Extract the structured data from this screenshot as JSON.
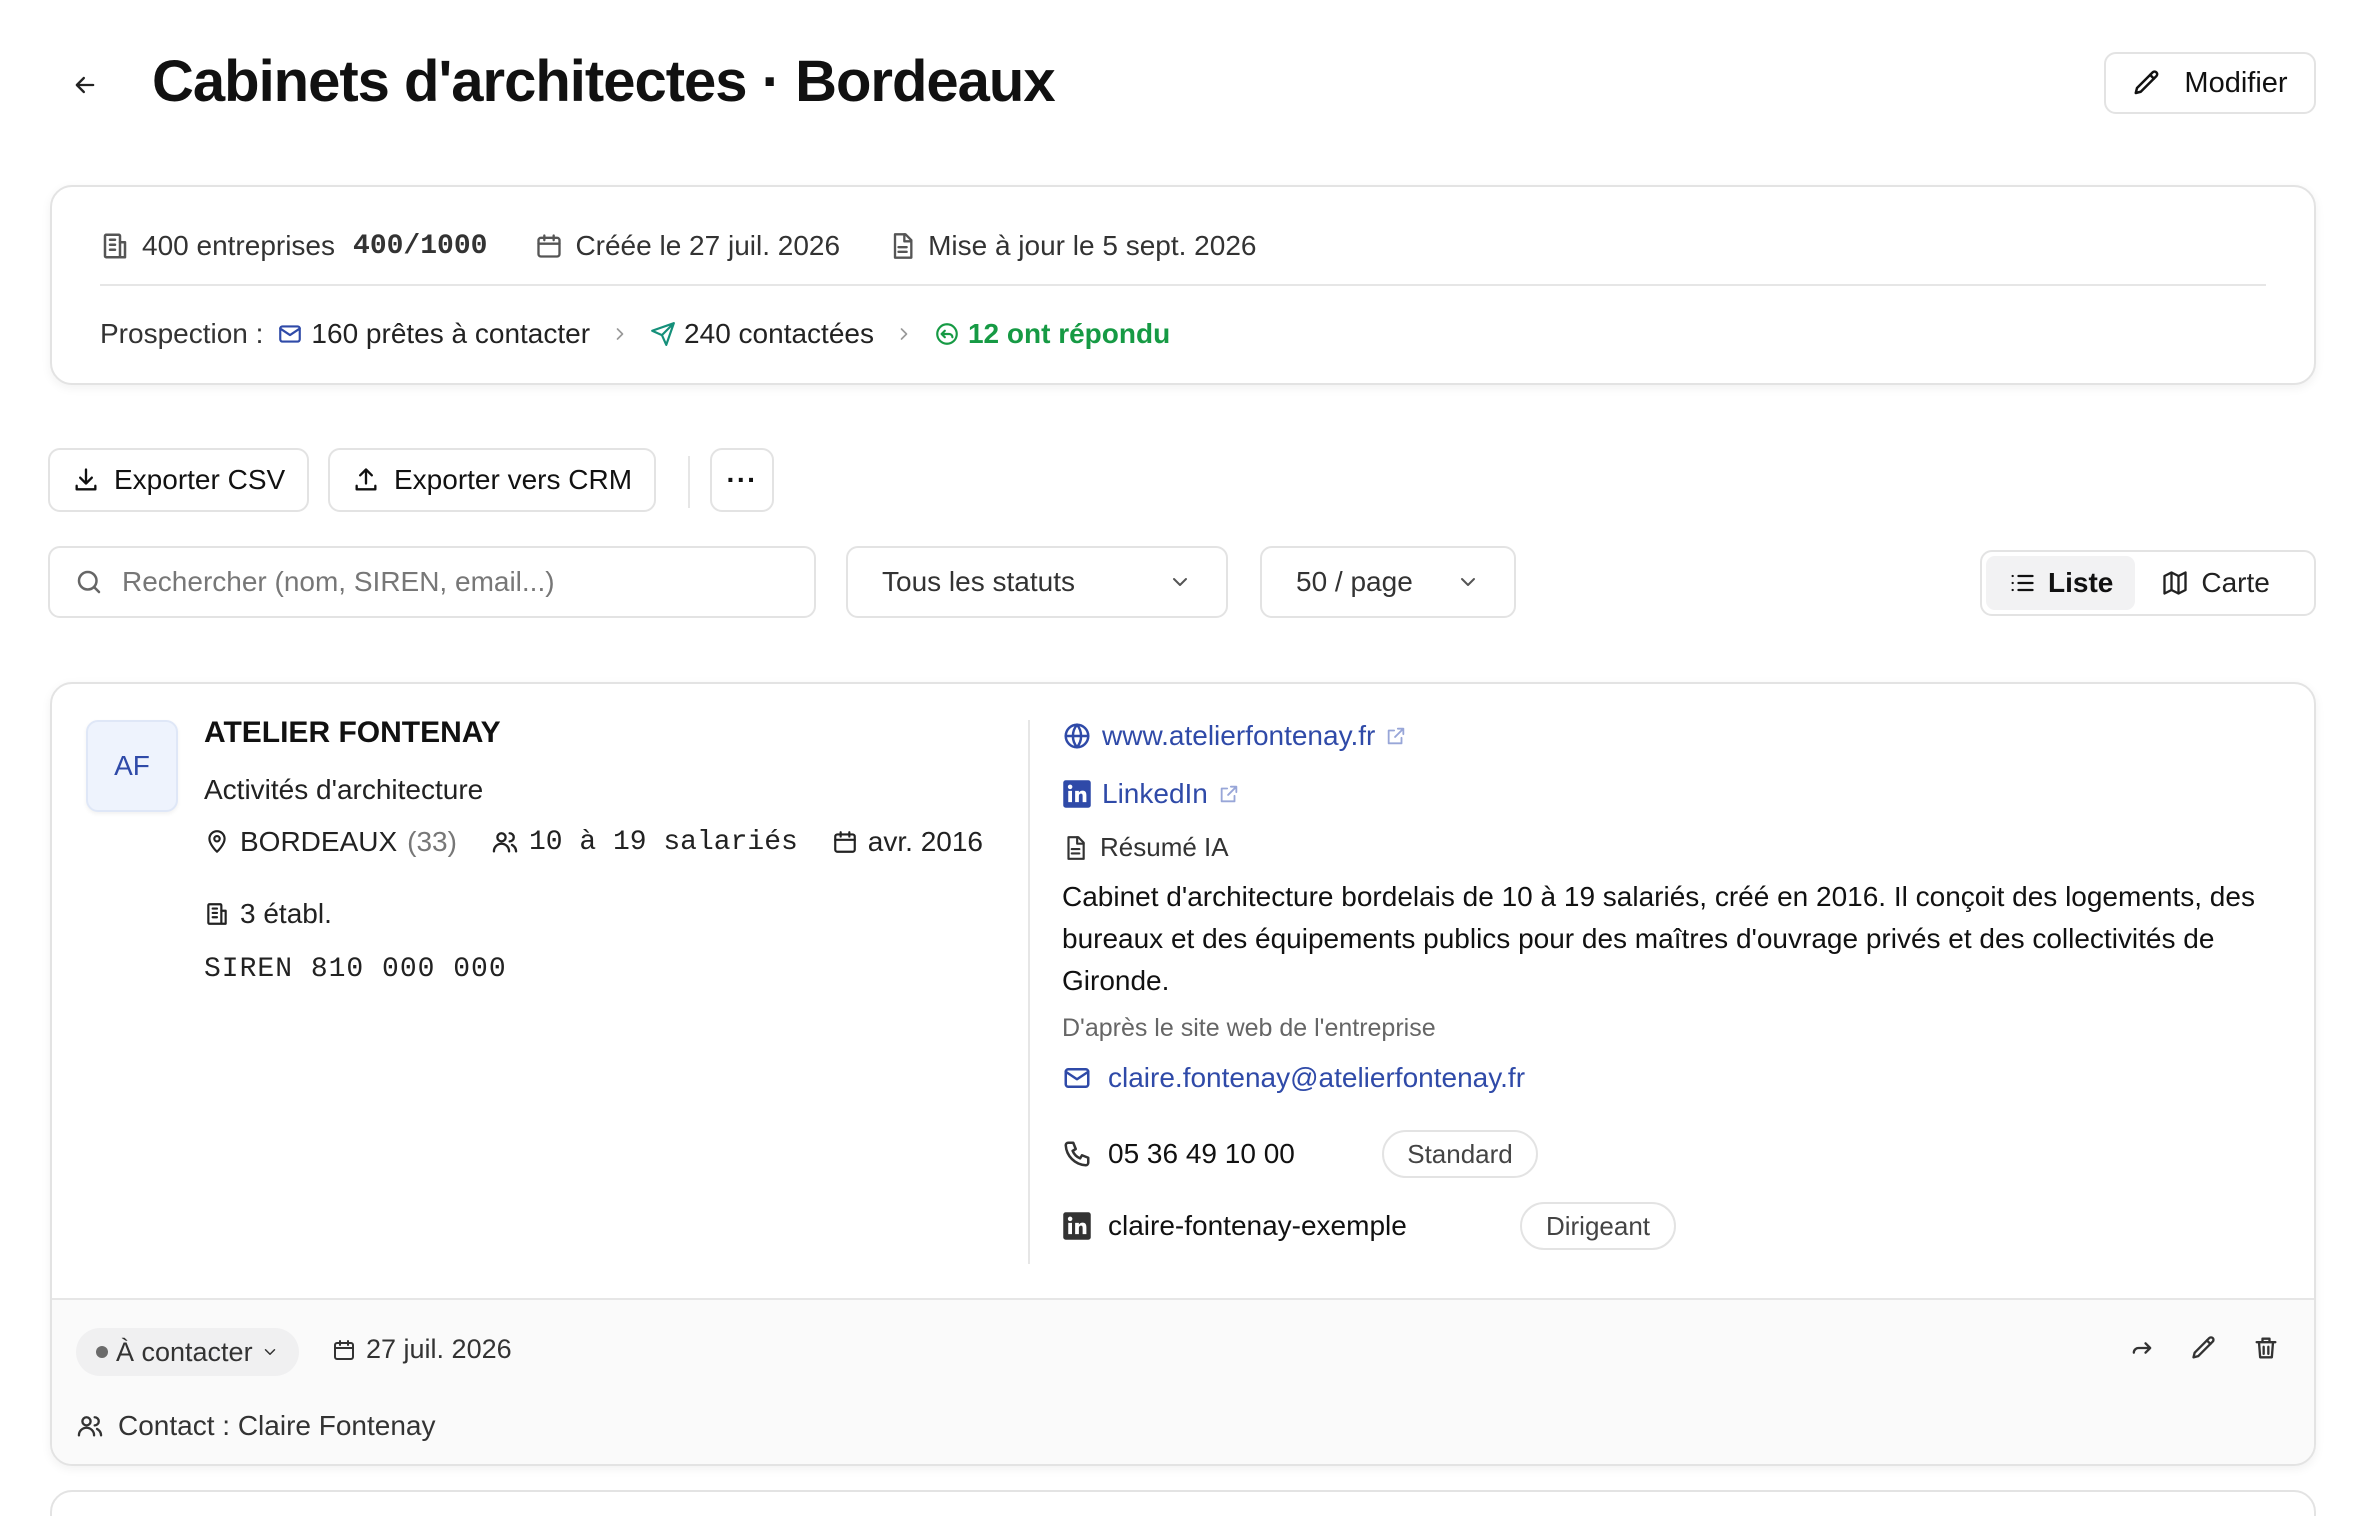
{
  "header": {
    "back_icon": "arrow-left-icon",
    "title": "Cabinets d'architectes · Bordeaux",
    "edit_label": "Modifier"
  },
  "info": {
    "companies_label": "400 entreprises",
    "quota": "400/1000",
    "created": "Créée le 27 juil. 2026",
    "updated": "Mise à jour le 5 sept. 2026",
    "prospection_label": "Prospection :",
    "ready": "160 prêtes à contacter",
    "contacted": "240 contactées",
    "replied": "12 ont répondu"
  },
  "toolbar": {
    "export_csv": "Exporter CSV",
    "export_crm": "Exporter vers CRM",
    "more": "···"
  },
  "filters": {
    "search_placeholder": "Rechercher (nom, SIREN, email...)",
    "status_value": "Tous les statuts",
    "page_size_value": "50 / page",
    "view_list": "Liste",
    "view_map": "Carte",
    "active_view": "Liste"
  },
  "company": {
    "initials": "AF",
    "name": "ATELIER FONTENAY",
    "activity": "Activités d'architecture",
    "city": "BORDEAUX",
    "dept": "(33)",
    "employees": "10 à 19 salariés",
    "founded": "avr. 2016",
    "establishments": "3 établ.",
    "siren": "SIREN 810 000 000",
    "website": "www.atelierfontenay.fr",
    "linkedin": "LinkedIn",
    "ai_summary_label": "Résumé IA",
    "ai_summary": "Cabinet d'architecture bordelais de 10 à 19 salariés, créé en 2016. Il conçoit des logements, des bureaux et des équipements publics pour des maîtres d'ouvrage privés et des collectivités de Gironde.",
    "summary_source": "D'après le site web de l'entreprise",
    "email": "claire.fontenay@atelierfontenay.fr",
    "phone": "05 36 49 10 00",
    "phone_badge": "Standard",
    "linkedin_handle": "claire-fontenay-exemple",
    "linkedin_badge": "Dirigeant",
    "status": "À contacter",
    "status_date": "27 juil. 2026",
    "contact": "Contact : Claire Fontenay"
  },
  "colors": {
    "accent_blue": "#2f4aa8",
    "teal": "#15907a",
    "green": "#169a44",
    "border": "#e3e3e3"
  }
}
